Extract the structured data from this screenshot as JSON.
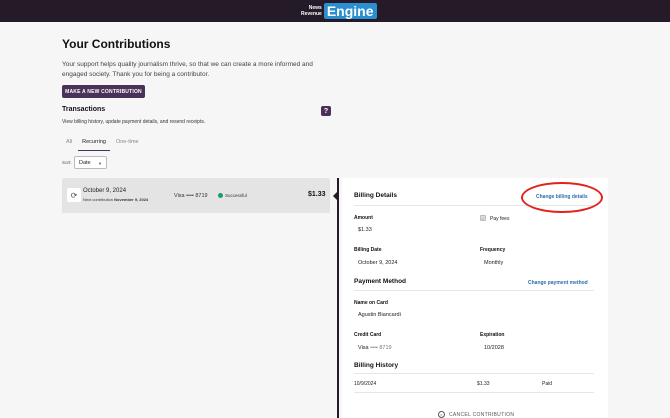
{
  "header": {
    "logo_line1": "News",
    "logo_line2": "Revenue",
    "logo_main": "Engine"
  },
  "page": {
    "title": "Your Contributions",
    "intro": "Your support helps quality journalism thrive, so that we can create a more informed and engaged society. Thank you for being a contributor.",
    "new_button": "MAKE A NEW CONTRIBUTION"
  },
  "transactions": {
    "heading": "Transactions",
    "subtext": "View billing history, update payment details, and resend receipts.",
    "help": "?",
    "tabs": [
      {
        "label": "All"
      },
      {
        "label": "Recurring"
      },
      {
        "label": "One-time"
      }
    ],
    "active_tab": "Recurring",
    "sort_label": "Sort:",
    "sort_value": "Date",
    "rows": [
      {
        "date": "October 9, 2024",
        "next_label": "Next contribution",
        "next_date": "November 9, 2024",
        "card": "Visa •••• 8719",
        "status": "Successful",
        "amount": "$1.33"
      }
    ]
  },
  "details": {
    "billing_heading": "Billing Details",
    "change_billing": "Change billing details",
    "amount_label": "Amount",
    "amount_value": "$1.33",
    "pay_fees_label": "Pay fees",
    "pay_fees_checked": true,
    "billing_date_label": "Billing Date",
    "billing_date_value": "October 9, 2024",
    "frequency_label": "Frequency",
    "frequency_value": "Monthly",
    "payment_heading": "Payment Method",
    "change_payment": "Change payment method",
    "name_label": "Name on Card",
    "name_value": "Agustin Biancardi",
    "card_label": "Credit Card",
    "card_brand": "Visa",
    "card_number": "•••• 8719",
    "expiration_label": "Expiration",
    "expiration_value": "10/2028",
    "history_heading": "Billing History",
    "history": [
      {
        "date": "10/9/2024",
        "amount": "$1.33",
        "status": "Paid"
      }
    ],
    "cancel": "CANCEL CONTRIBUTION"
  },
  "colors": {
    "brand": "#4a3158",
    "header": "#241a28",
    "link": "#2a6fb0",
    "success": "#1a9a7a",
    "annotation": "#e0241c"
  }
}
